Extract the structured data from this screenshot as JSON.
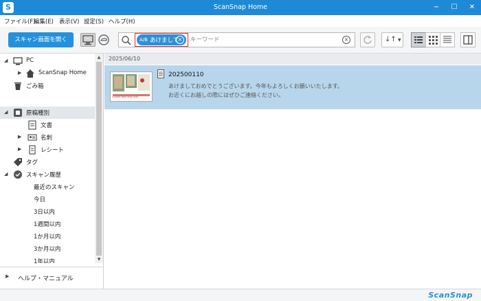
{
  "window": {
    "title": "ScanSnap Home",
    "logo_glyph": "S",
    "minimize": "−",
    "maximize": "☐",
    "close": "✕"
  },
  "menu": [
    "ファイル(F)",
    "編集(E)",
    "表示(V)",
    "設定(S)",
    "ヘルプ(H)"
  ],
  "toolbar": {
    "scan_button": "スキャン画面を開く",
    "search_chip_icon": "A/B",
    "search_chip_label": "あけまして",
    "search_placeholder": "キーワード",
    "sort_glyph": "↓↑"
  },
  "sidebar": {
    "items": [
      {
        "label": "PC",
        "icon": "computer-icon"
      },
      {
        "label": "ScanSnap Home",
        "icon": "home-icon"
      },
      {
        "label": "ごみ箱",
        "icon": "trash-icon"
      },
      {
        "label": "原稿種別",
        "icon": "document-type-icon"
      },
      {
        "label": "文書",
        "icon": "document-icon"
      },
      {
        "label": "名刺",
        "icon": "business-card-icon"
      },
      {
        "label": "レシート",
        "icon": "receipt-icon"
      },
      {
        "label": "タグ",
        "icon": "tag-icon"
      },
      {
        "label": "スキャン履歴",
        "icon": "history-icon"
      },
      {
        "label": "最近のスキャン"
      },
      {
        "label": "今日"
      },
      {
        "label": "3日以内"
      },
      {
        "label": "1週間以内"
      },
      {
        "label": "1か月以内"
      },
      {
        "label": "3か月以内"
      },
      {
        "label": "1年以内"
      }
    ],
    "help": "ヘルプ・マニュアル"
  },
  "content": {
    "date_group": "2025/06/10",
    "file": {
      "name": "202500110",
      "line1": "あけましておめでとうございます。今年もよろしくお願いいたします。",
      "line2": "お近くにお越しの際にはぜひご連絡ください。",
      "thumb_caption": "A HAPPY NEW YEAR 2009"
    }
  },
  "status": {
    "brand": "ScanSnap"
  },
  "colors": {
    "titlebar": "#1e8ad6",
    "accent": "#2491dd",
    "selected_row": "#b7d6ec",
    "search_highlight": "#e2292a"
  }
}
